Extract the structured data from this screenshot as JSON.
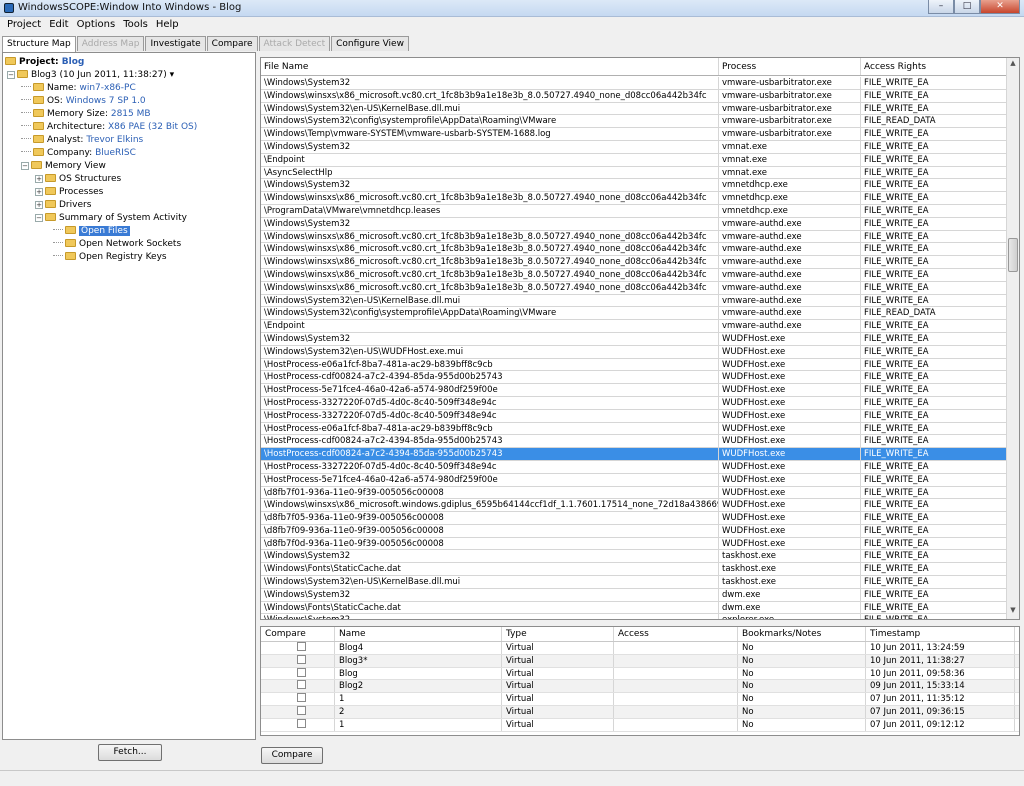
{
  "window": {
    "title": "WindowsSCOPE:Window Into Windows - Blog",
    "minimize": "–",
    "maximize": "□",
    "close": "✕"
  },
  "menu": [
    "Project",
    "Edit",
    "Options",
    "Tools",
    "Help"
  ],
  "tabs": [
    {
      "label": "Structure Map",
      "state": "active"
    },
    {
      "label": "Address Map",
      "state": "disabled"
    },
    {
      "label": "Investigate",
      "state": "normal"
    },
    {
      "label": "Compare",
      "state": "normal"
    },
    {
      "label": "Attack Detect",
      "state": "disabled"
    },
    {
      "label": "Configure View",
      "state": "normal"
    }
  ],
  "tree": {
    "project_label": "Project:",
    "project_name": "Blog",
    "snapshot": "Blog3 (10 Jun 2011, 11:38:27)",
    "props": [
      {
        "key": "Name:",
        "value": "win7-x86-PC"
      },
      {
        "key": "OS:",
        "value": "Windows 7 SP 1.0"
      },
      {
        "key": "Memory Size:",
        "value": "2815 MB"
      },
      {
        "key": "Architecture:",
        "value": "X86 PAE (32 Bit OS)"
      },
      {
        "key": "Analyst:",
        "value": "Trevor Elkins"
      },
      {
        "key": "Company:",
        "value": "BlueRISC"
      }
    ],
    "memory_view": "Memory View",
    "mv_children": [
      "OS Structures",
      "Processes",
      "Drivers",
      "Summary of System Activity"
    ],
    "summary_children": [
      "Open Files",
      "Open Network Sockets",
      "Open Registry Keys"
    ]
  },
  "fetch_label": "Fetch...",
  "files": {
    "headers": [
      "File Name",
      "Process",
      "Access Rights"
    ],
    "selected_index": 29,
    "rows": [
      [
        "\\Windows\\System32",
        "vmware-usbarbitrator.exe",
        "FILE_WRITE_EA"
      ],
      [
        "\\Windows\\winsxs\\x86_microsoft.vc80.crt_1fc8b3b9a1e18e3b_8.0.50727.4940_none_d08cc06a442b34fc",
        "vmware-usbarbitrator.exe",
        "FILE_WRITE_EA"
      ],
      [
        "\\Windows\\System32\\en-US\\KernelBase.dll.mui",
        "vmware-usbarbitrator.exe",
        "FILE_WRITE_EA"
      ],
      [
        "\\Windows\\System32\\config\\systemprofile\\AppData\\Roaming\\VMware",
        "vmware-usbarbitrator.exe",
        "FILE_READ_DATA"
      ],
      [
        "\\Windows\\Temp\\vmware-SYSTEM\\vmware-usbarb-SYSTEM-1688.log",
        "vmware-usbarbitrator.exe",
        "FILE_WRITE_EA"
      ],
      [
        "\\Windows\\System32",
        "vmnat.exe",
        "FILE_WRITE_EA"
      ],
      [
        "\\Endpoint",
        "vmnat.exe",
        "FILE_WRITE_EA"
      ],
      [
        "\\AsyncSelectHlp",
        "vmnat.exe",
        "FILE_WRITE_EA"
      ],
      [
        "\\Windows\\System32",
        "vmnetdhcp.exe",
        "FILE_WRITE_EA"
      ],
      [
        "\\Windows\\winsxs\\x86_microsoft.vc80.crt_1fc8b3b9a1e18e3b_8.0.50727.4940_none_d08cc06a442b34fc",
        "vmnetdhcp.exe",
        "FILE_WRITE_EA"
      ],
      [
        "\\ProgramData\\VMware\\vmnetdhcp.leases",
        "vmnetdhcp.exe",
        "FILE_WRITE_EA"
      ],
      [
        "\\Windows\\System32",
        "vmware-authd.exe",
        "FILE_WRITE_EA"
      ],
      [
        "\\Windows\\winsxs\\x86_microsoft.vc80.crt_1fc8b3b9a1e18e3b_8.0.50727.4940_none_d08cc06a442b34fc",
        "vmware-authd.exe",
        "FILE_WRITE_EA"
      ],
      [
        "\\Windows\\winsxs\\x86_microsoft.vc80.crt_1fc8b3b9a1e18e3b_8.0.50727.4940_none_d08cc06a442b34fc",
        "vmware-authd.exe",
        "FILE_WRITE_EA"
      ],
      [
        "\\Windows\\winsxs\\x86_microsoft.vc80.crt_1fc8b3b9a1e18e3b_8.0.50727.4940_none_d08cc06a442b34fc",
        "vmware-authd.exe",
        "FILE_WRITE_EA"
      ],
      [
        "\\Windows\\winsxs\\x86_microsoft.vc80.crt_1fc8b3b9a1e18e3b_8.0.50727.4940_none_d08cc06a442b34fc",
        "vmware-authd.exe",
        "FILE_WRITE_EA"
      ],
      [
        "\\Windows\\winsxs\\x86_microsoft.vc80.crt_1fc8b3b9a1e18e3b_8.0.50727.4940_none_d08cc06a442b34fc",
        "vmware-authd.exe",
        "FILE_WRITE_EA"
      ],
      [
        "\\Windows\\System32\\en-US\\KernelBase.dll.mui",
        "vmware-authd.exe",
        "FILE_WRITE_EA"
      ],
      [
        "\\Windows\\System32\\config\\systemprofile\\AppData\\Roaming\\VMware",
        "vmware-authd.exe",
        "FILE_READ_DATA"
      ],
      [
        "\\Endpoint",
        "vmware-authd.exe",
        "FILE_WRITE_EA"
      ],
      [
        "\\Windows\\System32",
        "WUDFHost.exe",
        "FILE_WRITE_EA"
      ],
      [
        "\\Windows\\System32\\en-US\\WUDFHost.exe.mui",
        "WUDFHost.exe",
        "FILE_WRITE_EA"
      ],
      [
        "\\HostProcess-e06a1fcf-8ba7-481a-ac29-b839bff8c9cb",
        "WUDFHost.exe",
        "FILE_WRITE_EA"
      ],
      [
        "\\HostProcess-cdf00824-a7c2-4394-85da-955d00b25743",
        "WUDFHost.exe",
        "FILE_WRITE_EA"
      ],
      [
        "\\HostProcess-5e71fce4-46a0-42a6-a574-980df259f00e",
        "WUDFHost.exe",
        "FILE_WRITE_EA"
      ],
      [
        "\\HostProcess-3327220f-07d5-4d0c-8c40-509ff348e94c",
        "WUDFHost.exe",
        "FILE_WRITE_EA"
      ],
      [
        "\\HostProcess-3327220f-07d5-4d0c-8c40-509ff348e94c",
        "WUDFHost.exe",
        "FILE_WRITE_EA"
      ],
      [
        "\\HostProcess-e06a1fcf-8ba7-481a-ac29-b839bff8c9cb",
        "WUDFHost.exe",
        "FILE_WRITE_EA"
      ],
      [
        "\\HostProcess-cdf00824-a7c2-4394-85da-955d00b25743",
        "WUDFHost.exe",
        "FILE_WRITE_EA"
      ],
      [
        "\\HostProcess-cdf00824-a7c2-4394-85da-955d00b25743",
        "WUDFHost.exe",
        "FILE_WRITE_EA"
      ],
      [
        "\\HostProcess-3327220f-07d5-4d0c-8c40-509ff348e94c",
        "WUDFHost.exe",
        "FILE_WRITE_EA"
      ],
      [
        "\\HostProcess-5e71fce4-46a0-42a6-a574-980df259f00e",
        "WUDFHost.exe",
        "FILE_WRITE_EA"
      ],
      [
        "\\d8fb7f01-936a-11e0-9f39-005056c00008",
        "WUDFHost.exe",
        "FILE_WRITE_EA"
      ],
      [
        "\\Windows\\winsxs\\x86_microsoft.windows.gdiplus_6595b64144ccf1df_1.1.7601.17514_none_72d18a4386696c80",
        "WUDFHost.exe",
        "FILE_WRITE_EA"
      ],
      [
        "\\d8fb7f05-936a-11e0-9f39-005056c00008",
        "WUDFHost.exe",
        "FILE_WRITE_EA"
      ],
      [
        "\\d8fb7f09-936a-11e0-9f39-005056c00008",
        "WUDFHost.exe",
        "FILE_WRITE_EA"
      ],
      [
        "\\d8fb7f0d-936a-11e0-9f39-005056c00008",
        "WUDFHost.exe",
        "FILE_WRITE_EA"
      ],
      [
        "\\Windows\\System32",
        "taskhost.exe",
        "FILE_WRITE_EA"
      ],
      [
        "\\Windows\\Fonts\\StaticCache.dat",
        "taskhost.exe",
        "FILE_WRITE_EA"
      ],
      [
        "\\Windows\\System32\\en-US\\KernelBase.dll.mui",
        "taskhost.exe",
        "FILE_WRITE_EA"
      ],
      [
        "\\Windows\\System32",
        "dwm.exe",
        "FILE_WRITE_EA"
      ],
      [
        "\\Windows\\Fonts\\StaticCache.dat",
        "dwm.exe",
        "FILE_WRITE_EA"
      ],
      [
        "\\Windows\\System32",
        "explorer.exe",
        "FILE_WRITE_EA"
      ]
    ]
  },
  "snapshots": {
    "headers": [
      "Compare",
      "Name",
      "Type",
      "Access",
      "Bookmarks/Notes",
      "Timestamp"
    ],
    "rows": [
      [
        "Blog4",
        "Virtual",
        "",
        "No",
        "10 Jun 2011, 13:24:59"
      ],
      [
        "Blog3*",
        "Virtual",
        "",
        "No",
        "10 Jun 2011, 11:38:27"
      ],
      [
        "Blog",
        "Virtual",
        "",
        "No",
        "10 Jun 2011, 09:58:36"
      ],
      [
        "Blog2",
        "Virtual",
        "",
        "No",
        "09 Jun 2011, 15:33:14"
      ],
      [
        "1",
        "Virtual",
        "",
        "No",
        "07 Jun 2011, 11:35:12"
      ],
      [
        "2",
        "Virtual",
        "",
        "No",
        "07 Jun 2011, 09:36:15"
      ],
      [
        "1",
        "Virtual",
        "",
        "No",
        "07 Jun 2011, 09:12:12"
      ]
    ]
  },
  "compare_label": "Compare"
}
